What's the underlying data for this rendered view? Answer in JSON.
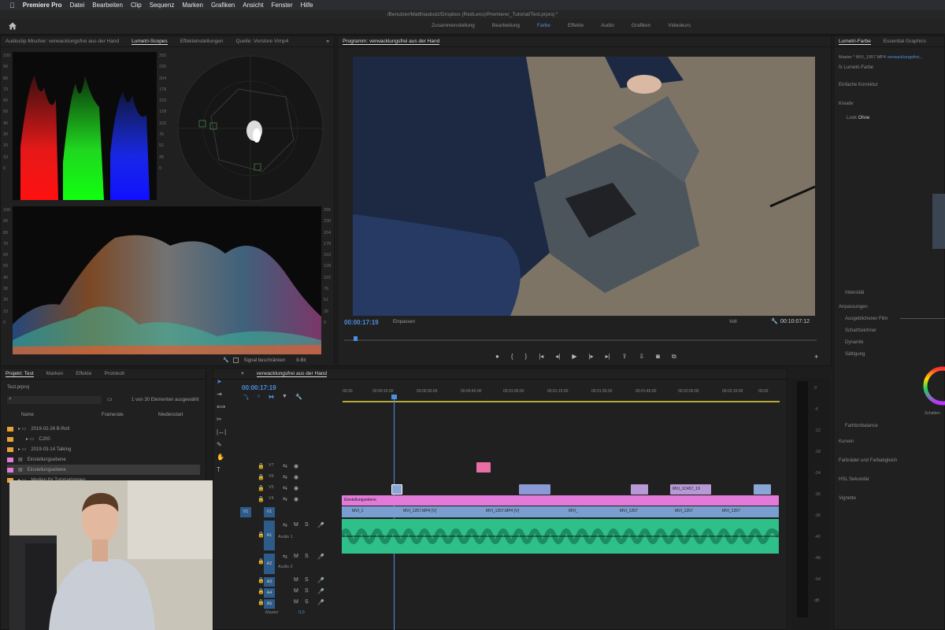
{
  "menubar": {
    "apple": "",
    "app_name": "Premiere Pro",
    "items": [
      "Datei",
      "Bearbeiten",
      "Clip",
      "Sequenz",
      "Marken",
      "Grafiken",
      "Ansicht",
      "Fenster",
      "Hilfe"
    ]
  },
  "window": {
    "title": "/Benutzer/Matthiasbutz/Dropbox (RedLens)/Premiere/_Tutorial/Test.prproj *"
  },
  "workspace": {
    "tabs": [
      "Zusammenstellung",
      "Bearbeitung",
      "Farbe",
      "Effekte",
      "Audio",
      "Grafiken",
      "Videokurs"
    ],
    "active": "Farbe"
  },
  "scopes_panel": {
    "tabs": [
      "Audioclip-Mischer: verwacklungsfrei aus der Hand",
      "Lumetri-Scopes",
      "Effekteinstellungen",
      "Quelle: Vorstore Vimp4"
    ],
    "active_tab": "Lumetri-Scopes",
    "parade_scale": [
      "100",
      "90",
      "80",
      "70",
      "60",
      "50",
      "40",
      "30",
      "20",
      "10",
      "0"
    ],
    "parade_scale_right": [
      "255",
      "230",
      "204",
      "178",
      "153",
      "128",
      "102",
      "76",
      "51",
      "26",
      "0"
    ],
    "wave_scale": [
      "100",
      "90",
      "80",
      "70",
      "60",
      "50",
      "40",
      "30",
      "20",
      "10",
      "0"
    ],
    "wave_scale_right": [
      "255",
      "230",
      "204",
      "178",
      "153",
      "128",
      "102",
      "76",
      "51",
      "26",
      "0"
    ],
    "signal_label": "Signal beschränken",
    "bit_depth": "8-Bit"
  },
  "program": {
    "title": "Programm: verwacklungsfrei aus der Hand",
    "timecode": "00:00:17:19",
    "fit": "Einpassen",
    "quality": "Voll",
    "duration": "00:10:07:12"
  },
  "lumetri": {
    "tabs": [
      "Lumetri-Farbe",
      "Essential Graphics"
    ],
    "master": "Master * MVI_1957.MP4",
    "clip": "verwacklungsfrei...",
    "fx_label": "Lumetri-Farbe",
    "sections": {
      "basic": "Einfache Korrektur",
      "creative": "Kreativ",
      "look_label": "Look",
      "look_value": "Ohne",
      "intensity": "Intensität",
      "adjustments": "Anpassungen",
      "faded_film": "Ausgeblichener Film",
      "sharpen": "Scharfzeichner",
      "vibrance": "Dynamik",
      "saturation": "Sättigung",
      "shadow": "Schatten",
      "tint_balance": "Farbtonbalance",
      "curves": "Kurven",
      "color_wheels": "Farbräder und Farbabgleich",
      "hsl": "HSL Sekundär",
      "vignette": "Vignette"
    }
  },
  "project": {
    "tabs": [
      "Projekt: Test",
      "Marken",
      "Effekte",
      "Protokoll"
    ],
    "file": "Test.prproj",
    "count": "1 von 30 Elementen ausgewählt",
    "columns": [
      "Name",
      "Framerate",
      "Medienstart"
    ],
    "items": [
      {
        "name": "2019-02-26 B-Roll",
        "color": "#e8a23a"
      },
      {
        "name": "C200",
        "color": "#e8a23a"
      },
      {
        "name": "2019-03-14 Talking",
        "color": "#e8a23a"
      },
      {
        "name": "Einstellungsebene",
        "color": "#e17ad8"
      },
      {
        "name": "Einstellungsebene",
        "color": "#e17ad8"
      },
      {
        "name": "Medien für Tutorialdateien",
        "color": "#e8a23a"
      }
    ]
  },
  "timeline": {
    "title": "verwacklungsfrei aus der Hand",
    "timecode": "00:00:17:19",
    "ruler": [
      "00:00",
      "00:00:15:00",
      "00:00:30:00",
      "00:00:45:00",
      "00:01:00:00",
      "00:01:15:00",
      "00:01:30:00",
      "00:01:45:00",
      "00:02:00:00",
      "00:02:15:00",
      "00:02"
    ],
    "tracks_video": [
      "V7",
      "V6",
      "V5",
      "V4",
      "V3",
      "V2",
      "V1"
    ],
    "tracks_audio": [
      "A1",
      "A2",
      "A3",
      "A4",
      "A5"
    ],
    "audio_names": [
      "Audio 1",
      "Audio 2"
    ],
    "master": "Master",
    "master_value": "0,0",
    "adjust_clip": "Einstellungsebene",
    "clip_labels": [
      "MVI_1",
      "MVI_1257.MP4 [V]",
      "MVI_1257.MP4 [V]",
      "MVI_",
      "MVI_1257",
      "MVI_1257",
      "MVI_1257",
      "MVI_1"
    ],
    "v3_label": "MVI_1C457_19"
  },
  "meter_scale": [
    "0",
    "-6",
    "-12",
    "-18",
    "-24",
    "-30",
    "-36",
    "-42",
    "-48",
    "-54",
    "dB"
  ]
}
